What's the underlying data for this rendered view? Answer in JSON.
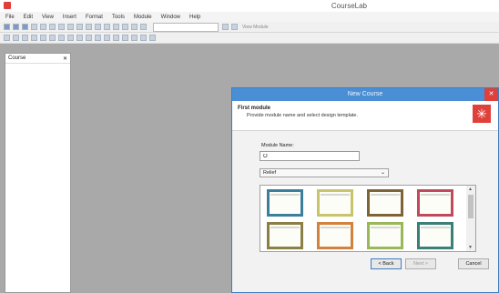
{
  "app": {
    "title": "CourseLab"
  },
  "menu": [
    "File",
    "Edit",
    "View",
    "Insert",
    "Format",
    "Tools",
    "Module",
    "Window",
    "Help"
  ],
  "toolbar": {
    "view_module_label": "View Module"
  },
  "course_panel": {
    "title": "Course",
    "close": "✕"
  },
  "dialog": {
    "title": "New Course",
    "close": "✕",
    "step_title": "First module",
    "step_subtitle": "Provide module name and select design template.",
    "module_name_label": "Module Name:",
    "module_name_value": "O",
    "design_value": "Relief",
    "design_chevron": "⌄",
    "templates": [
      {
        "color": "#3b7f9c"
      },
      {
        "color": "#c8c46b"
      },
      {
        "color": "#7d6336"
      },
      {
        "color": "#c04a5a"
      },
      {
        "color": "#8a8045"
      },
      {
        "color": "#d2823c"
      },
      {
        "color": "#98b85a"
      },
      {
        "color": "#3a7f78"
      }
    ],
    "scroll_up": "▲",
    "scroll_down": "▼",
    "back_label": "< Back",
    "next_label": "Next >",
    "cancel_label": "Cancel"
  },
  "colors": {
    "accent": "#4a8fd6",
    "close_red": "#e0403a"
  }
}
